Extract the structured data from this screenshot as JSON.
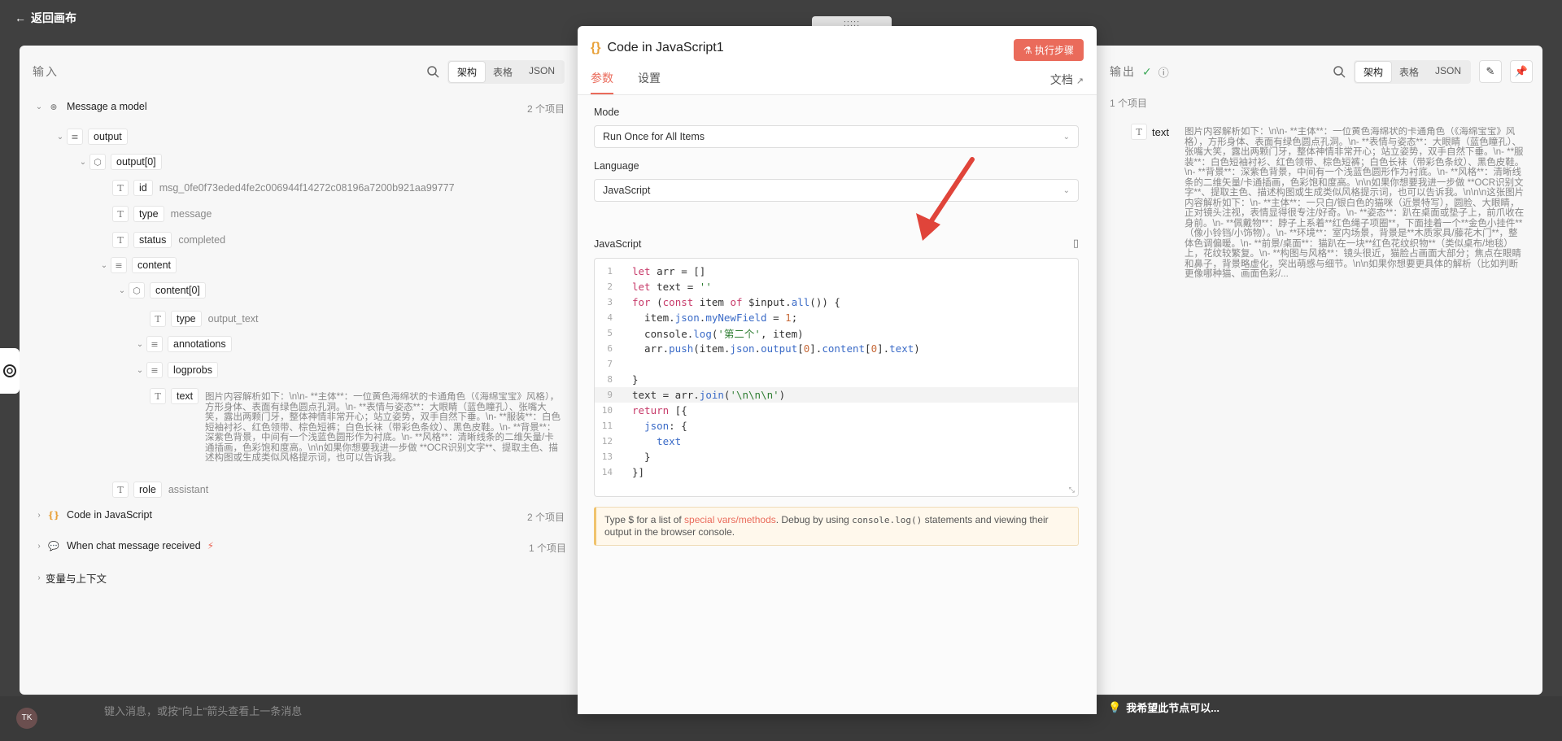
{
  "background": {
    "back_label": "返回画布",
    "chat_placeholder": "键入消息，或按\"向上\"箭头查看上一条消息",
    "bottom_hint": "我希望此节点可以...",
    "avatar_text": "TK"
  },
  "input_panel": {
    "title": "输入",
    "views": [
      "架构",
      "表格",
      "JSON"
    ],
    "active_view": "架构",
    "tree": {
      "message_model": {
        "label": "Message a model",
        "count": "2 个项目"
      },
      "output": "output",
      "output0": "output[0]",
      "id_key": "id",
      "id_val": "msg_0fe0f73eded4fe2c006944f14272c08196a7200b921aa99777",
      "type_key": "type",
      "type_val": "message",
      "status_key": "status",
      "status_val": "completed",
      "content": "content",
      "content0": "content[0]",
      "ctype_key": "type",
      "ctype_val": "output_text",
      "annotations": "annotations",
      "logprobs": "logprobs",
      "text_key": "text",
      "text_val": "图片内容解析如下：\\n\\n- **主体**：一位黄色海绵状的卡通角色（《海绵宝宝》风格），方形身体、表面有绿色圆点孔洞。\\n- **表情与姿态**：大眼睛（蓝色瞳孔）、张嘴大笑，露出两颗门牙，整体神情非常开心；站立姿势，双手自然下垂。\\n- **服装**：白色短袖衬衫、红色领带、棕色短裤；白色长袜（带彩色条纹）、黑色皮鞋。\\n- **背景**：深紫色背景，中间有一个浅蓝色圆形作为衬底。\\n- **风格**：清晰线条的二维矢量/卡通插画，色彩饱和度高。\\n\\n如果你想要我进一步做 **OCR识别文字**、提取主色、描述构图或生成类似风格提示词，也可以告诉我。",
      "role_key": "role",
      "role_val": "assistant",
      "code_node": {
        "label": "Code in JavaScript",
        "count": "2 个项目"
      },
      "chat_node": {
        "label": "When chat message received",
        "count": "1 个项目"
      },
      "vars": "变量与上下文"
    }
  },
  "modal": {
    "title": "Code in JavaScript1",
    "execute_label": "执行步骤",
    "tabs": [
      "参数",
      "设置"
    ],
    "doc_label": "文档",
    "mode_label": "Mode",
    "mode_value": "Run Once for All Items",
    "language_label": "Language",
    "language_value": "JavaScript",
    "code_label": "JavaScript",
    "code_lines": [
      "let arr = []",
      "let text = ''",
      "for (const item of $input.all()) {",
      "  item.json.myNewField = 1;",
      "  console.log('第二个', item)",
      "  arr.push(item.json.output[0].content[0].text)",
      "",
      "}",
      "text = arr.join('\\n\\n\\n')",
      "return [{",
      "  json: {",
      "    text",
      "  }",
      "}]"
    ],
    "hint_pre": "Type $ for a list of ",
    "hint_link": "special vars/methods",
    "hint_mid": ". Debug by using ",
    "hint_code": "console.log()",
    "hint_post": " statements and viewing their output in the browser console."
  },
  "output_panel": {
    "title": "输出",
    "views": [
      "架构",
      "表格",
      "JSON"
    ],
    "active_view": "架构",
    "item_count": "1 个项目",
    "text_key": "text",
    "text_val": "图片内容解析如下：\\n\\n- **主体**：一位黄色海绵状的卡通角色（《海绵宝宝》风格），方形身体、表面有绿色圆点孔洞。\\n- **表情与姿态**：大眼睛（蓝色瞳孔）、张嘴大笑，露出两颗门牙，整体神情非常开心；站立姿势，双手自然下垂。\\n- **服装**：白色短袖衬衫、红色领带、棕色短裤；白色长袜（带彩色条纹）、黑色皮鞋。\\n- **背景**：深紫色背景，中间有一个浅蓝色圆形作为衬底。\\n- **风格**：清晰线条的二维矢量/卡通插画，色彩饱和度高。\\n\\n如果你想要我进一步做 **OCR识别文字**、提取主色、描述构图或生成类似风格提示词，也可以告诉我。\\n\\n\\n这张图片内容解析如下：\\n- **主体**：一只白/银白色的猫咪（近景特写），圆脸、大眼睛，正对镜头注视，表情显得很专注/好奇。\\n- **姿态**：趴在桌面或垫子上，前爪收在身前。\\n- **佩戴物**：脖子上系着**红色绳子项圈**，下面挂着一个**金色小挂件**（像小铃铛/小饰物）。\\n- **环境**：室内场景，背景是**木质家具/藤花木门**，整体色调偏暖。\\n- **前景/桌面**：猫趴在一块**红色花纹织物**（类似桌布/地毯）上，花纹较繁复。\\n- **构图与风格**：镜头很近，猫脸占画面大部分；焦点在眼睛和鼻子，背景略虚化，突出萌感与细节。\\n\\n如果你想要更具体的解析（比如判断更像哪种猫、画面色彩/..."
  },
  "colors": {
    "accent": "#ea6b5b",
    "icon_orange": "#e8a13a",
    "success": "#3aa757"
  }
}
